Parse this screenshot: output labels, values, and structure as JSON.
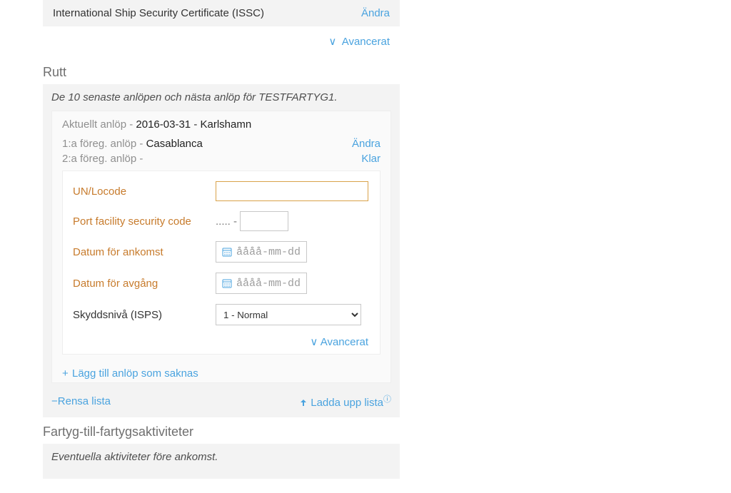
{
  "colors": {
    "link": "#4aa3df",
    "warnLabel": "#c77b2c"
  },
  "issc_row": {
    "title": "International Ship Security Certificate (ISSC)",
    "action": "Ändra"
  },
  "advanced_label": "Avancerat",
  "route": {
    "heading": "Rutt",
    "caption": "De 10 senaste anlöpen och nästa anlöp för TESTFARTYG1.",
    "current": {
      "label": "Aktuellt anlöp",
      "date": "2016-03-31",
      "port": "Karlshamn"
    },
    "prev1": {
      "label": "1:a föreg. anlöp",
      "port": "Casablanca",
      "action": "Ändra"
    },
    "prev2": {
      "label": "2:a föreg. anlöp",
      "port": "",
      "action": "Klar"
    },
    "form": {
      "locode_label": "UN/Locode",
      "locode_value": "",
      "pfsc_label": "Port facility security code",
      "pfsc_prefix": ".....  -",
      "pfsc_value": "",
      "arr_label": "Datum för ankomst",
      "dep_label": "Datum för avgång",
      "date_placeholder": "åååå-mm-dd",
      "isps_label": "Skyddsnivå (ISPS)",
      "isps_value": "1 - Normal"
    },
    "add_missing": "Lägg till anlöp som saknas",
    "clear_list": "Rensa lista",
    "upload_list": "Ladda upp lista"
  },
  "s2s": {
    "heading": "Fartyg-till-fartygsaktiviteter",
    "caption": "Eventuella aktiviteter före ankomst."
  }
}
